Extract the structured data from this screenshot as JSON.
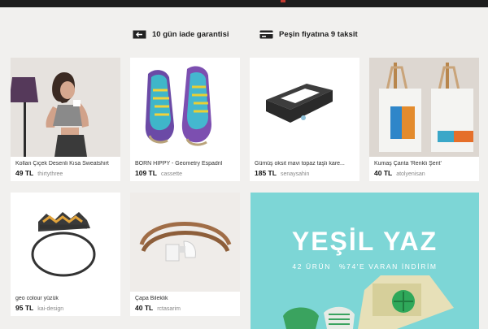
{
  "benefits": [
    {
      "label": "10 gün iade garantisi",
      "icon": "return-arrow-icon"
    },
    {
      "label": "Peşin fiyatına 9 taksit",
      "icon": "credit-card-icon"
    }
  ],
  "products": [
    {
      "title": "Kollan Çiçek Desenli Kısa Sweatshirt",
      "price": "49 TL",
      "seller": "thirtythree"
    },
    {
      "title": "BORN HIPPY - Geometry Espadril",
      "price": "109 TL",
      "seller": "cassette"
    },
    {
      "title": "Gümüş oksit mavi topaz taşlı kare...",
      "price": "185 TL",
      "seller": "senaysahin"
    },
    {
      "title": "Kumaş Çanta 'Renkli Şerit'",
      "price": "40 TL",
      "seller": "atolyenisan"
    },
    {
      "title": "geo colour yüzük",
      "price": "95 TL",
      "seller": "kai-design"
    },
    {
      "title": "Çapa Bileklik",
      "price": "40 TL",
      "seller": "rctasarim"
    }
  ],
  "promo": {
    "title": "YEŞİL YAZ",
    "count": "42 ÜRÜN",
    "discount": "%74'E VARAN İNDİRİM",
    "background": "#7dd6d6"
  },
  "colors": {
    "background": "#f1f0ee",
    "topbar": "#1d1d1d",
    "accent": "#c2392f"
  }
}
